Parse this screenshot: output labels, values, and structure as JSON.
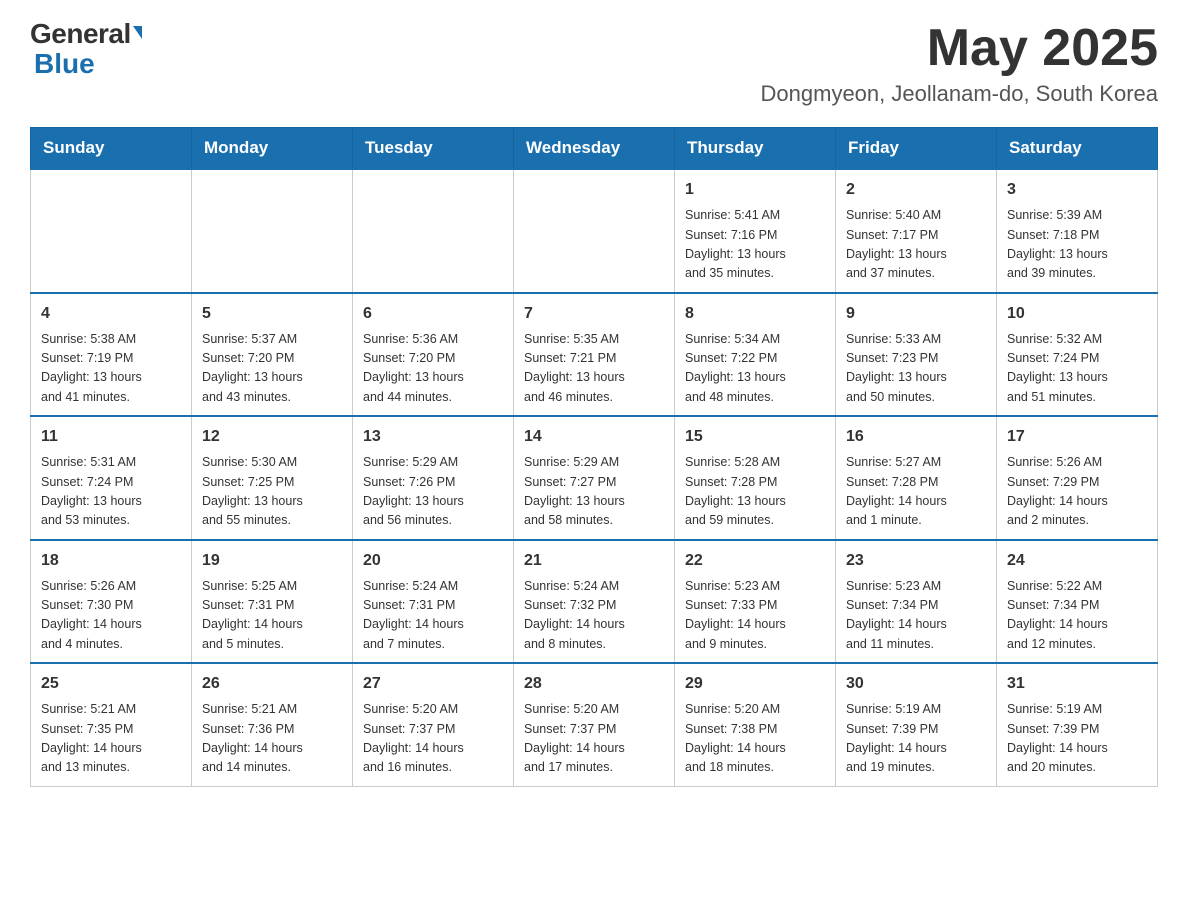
{
  "header": {
    "logo": {
      "general": "General",
      "blue": "Blue"
    },
    "title": "May 2025",
    "subtitle": "Dongmyeon, Jeollanam-do, South Korea"
  },
  "days_of_week": [
    "Sunday",
    "Monday",
    "Tuesday",
    "Wednesday",
    "Thursday",
    "Friday",
    "Saturday"
  ],
  "weeks": [
    {
      "days": [
        {
          "number": "",
          "info": ""
        },
        {
          "number": "",
          "info": ""
        },
        {
          "number": "",
          "info": ""
        },
        {
          "number": "",
          "info": ""
        },
        {
          "number": "1",
          "info": "Sunrise: 5:41 AM\nSunset: 7:16 PM\nDaylight: 13 hours\nand 35 minutes."
        },
        {
          "number": "2",
          "info": "Sunrise: 5:40 AM\nSunset: 7:17 PM\nDaylight: 13 hours\nand 37 minutes."
        },
        {
          "number": "3",
          "info": "Sunrise: 5:39 AM\nSunset: 7:18 PM\nDaylight: 13 hours\nand 39 minutes."
        }
      ]
    },
    {
      "days": [
        {
          "number": "4",
          "info": "Sunrise: 5:38 AM\nSunset: 7:19 PM\nDaylight: 13 hours\nand 41 minutes."
        },
        {
          "number": "5",
          "info": "Sunrise: 5:37 AM\nSunset: 7:20 PM\nDaylight: 13 hours\nand 43 minutes."
        },
        {
          "number": "6",
          "info": "Sunrise: 5:36 AM\nSunset: 7:20 PM\nDaylight: 13 hours\nand 44 minutes."
        },
        {
          "number": "7",
          "info": "Sunrise: 5:35 AM\nSunset: 7:21 PM\nDaylight: 13 hours\nand 46 minutes."
        },
        {
          "number": "8",
          "info": "Sunrise: 5:34 AM\nSunset: 7:22 PM\nDaylight: 13 hours\nand 48 minutes."
        },
        {
          "number": "9",
          "info": "Sunrise: 5:33 AM\nSunset: 7:23 PM\nDaylight: 13 hours\nand 50 minutes."
        },
        {
          "number": "10",
          "info": "Sunrise: 5:32 AM\nSunset: 7:24 PM\nDaylight: 13 hours\nand 51 minutes."
        }
      ]
    },
    {
      "days": [
        {
          "number": "11",
          "info": "Sunrise: 5:31 AM\nSunset: 7:24 PM\nDaylight: 13 hours\nand 53 minutes."
        },
        {
          "number": "12",
          "info": "Sunrise: 5:30 AM\nSunset: 7:25 PM\nDaylight: 13 hours\nand 55 minutes."
        },
        {
          "number": "13",
          "info": "Sunrise: 5:29 AM\nSunset: 7:26 PM\nDaylight: 13 hours\nand 56 minutes."
        },
        {
          "number": "14",
          "info": "Sunrise: 5:29 AM\nSunset: 7:27 PM\nDaylight: 13 hours\nand 58 minutes."
        },
        {
          "number": "15",
          "info": "Sunrise: 5:28 AM\nSunset: 7:28 PM\nDaylight: 13 hours\nand 59 minutes."
        },
        {
          "number": "16",
          "info": "Sunrise: 5:27 AM\nSunset: 7:28 PM\nDaylight: 14 hours\nand 1 minute."
        },
        {
          "number": "17",
          "info": "Sunrise: 5:26 AM\nSunset: 7:29 PM\nDaylight: 14 hours\nand 2 minutes."
        }
      ]
    },
    {
      "days": [
        {
          "number": "18",
          "info": "Sunrise: 5:26 AM\nSunset: 7:30 PM\nDaylight: 14 hours\nand 4 minutes."
        },
        {
          "number": "19",
          "info": "Sunrise: 5:25 AM\nSunset: 7:31 PM\nDaylight: 14 hours\nand 5 minutes."
        },
        {
          "number": "20",
          "info": "Sunrise: 5:24 AM\nSunset: 7:31 PM\nDaylight: 14 hours\nand 7 minutes."
        },
        {
          "number": "21",
          "info": "Sunrise: 5:24 AM\nSunset: 7:32 PM\nDaylight: 14 hours\nand 8 minutes."
        },
        {
          "number": "22",
          "info": "Sunrise: 5:23 AM\nSunset: 7:33 PM\nDaylight: 14 hours\nand 9 minutes."
        },
        {
          "number": "23",
          "info": "Sunrise: 5:23 AM\nSunset: 7:34 PM\nDaylight: 14 hours\nand 11 minutes."
        },
        {
          "number": "24",
          "info": "Sunrise: 5:22 AM\nSunset: 7:34 PM\nDaylight: 14 hours\nand 12 minutes."
        }
      ]
    },
    {
      "days": [
        {
          "number": "25",
          "info": "Sunrise: 5:21 AM\nSunset: 7:35 PM\nDaylight: 14 hours\nand 13 minutes."
        },
        {
          "number": "26",
          "info": "Sunrise: 5:21 AM\nSunset: 7:36 PM\nDaylight: 14 hours\nand 14 minutes."
        },
        {
          "number": "27",
          "info": "Sunrise: 5:20 AM\nSunset: 7:37 PM\nDaylight: 14 hours\nand 16 minutes."
        },
        {
          "number": "28",
          "info": "Sunrise: 5:20 AM\nSunset: 7:37 PM\nDaylight: 14 hours\nand 17 minutes."
        },
        {
          "number": "29",
          "info": "Sunrise: 5:20 AM\nSunset: 7:38 PM\nDaylight: 14 hours\nand 18 minutes."
        },
        {
          "number": "30",
          "info": "Sunrise: 5:19 AM\nSunset: 7:39 PM\nDaylight: 14 hours\nand 19 minutes."
        },
        {
          "number": "31",
          "info": "Sunrise: 5:19 AM\nSunset: 7:39 PM\nDaylight: 14 hours\nand 20 minutes."
        }
      ]
    }
  ]
}
